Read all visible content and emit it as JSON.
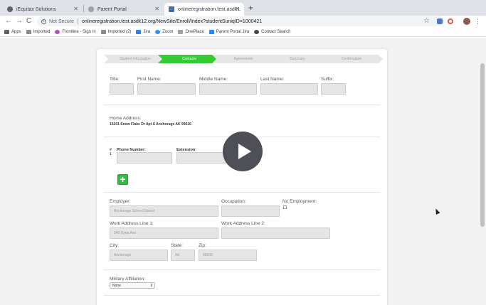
{
  "browser": {
    "tabs": [
      {
        "title": "iEquitax Solutions",
        "favicon_color": "#5f6368"
      },
      {
        "title": "Parent Portal",
        "favicon_color": "#9aa0a6"
      },
      {
        "title": "onlineregistration.test.asdk12...",
        "favicon_color": "#4a6fa5"
      }
    ],
    "new_tab_label": "+",
    "security_label": "Not Secure",
    "url": "onlineregistration.test.asdk12.org/NewSite/Enroll/Index?studentSuniqID=1000421"
  },
  "bookmarks": [
    {
      "label": "Apps",
      "icon_color": "#5f6368"
    },
    {
      "label": "Imported",
      "icon_color": "#8a8a8a"
    },
    {
      "label": "Frontline - Sign In",
      "icon_color": "#b04cc7"
    },
    {
      "label": "Imported (2)",
      "icon_color": "#8a8a8a"
    },
    {
      "label": "Jira",
      "icon_color": "#2684ff"
    },
    {
      "label": "Zoom",
      "icon_color": "#2d8cff"
    },
    {
      "label": "OnePlace",
      "icon_color": "#a0a0a0"
    },
    {
      "label": "Parent Portal Jira",
      "icon_color": "#2684ff"
    },
    {
      "label": "Contact Search",
      "icon_color": "#444444"
    }
  ],
  "steps": [
    {
      "label": "Student Information",
      "active": false
    },
    {
      "label": "Contacts",
      "active": true
    },
    {
      "label": "Agreements",
      "active": false
    },
    {
      "label": "Summary",
      "active": false
    },
    {
      "label": "Confirmation",
      "active": false
    }
  ],
  "form": {
    "name_labels": {
      "title": "Title:",
      "first": "First Name:",
      "middle": "Middle Name:",
      "last": "Last Name:",
      "suffix": "Suffix:"
    },
    "home_address_label": "Home Address:",
    "home_address_value": "15201 Snow Flake Dr Apt A Anchorage AK 99516",
    "phone": {
      "index_header": "#",
      "index_value": "1",
      "number_label": "Phone Number:",
      "extension_label": "Extension:"
    },
    "add_button_label": "+",
    "employer_label": "Employer:",
    "employer_value": "Anchorage School District",
    "occupation_label": "Occupation:",
    "no_employment_label": "No Employment:",
    "work_address1_label": "Work Address Line 1:",
    "work_address1_value": "540 Dyea Ave",
    "work_address2_label": "Work Address Line 2:",
    "city_label": "City:",
    "city_value": "Anchorage",
    "state_label": "State:",
    "state_value": "AK",
    "zip_label": "Zip:",
    "zip_value": "99505",
    "military_label": "Military Affiliation:",
    "military_value": "None"
  },
  "colors": {
    "active_step": "#33cc33",
    "add_button": "#33bb44",
    "page_background": "#f2f2f2"
  },
  "icons": {
    "play": "play-icon",
    "back": "back-arrow-icon",
    "forward": "forward-arrow-icon",
    "reload": "reload-icon",
    "star": "star-icon"
  }
}
